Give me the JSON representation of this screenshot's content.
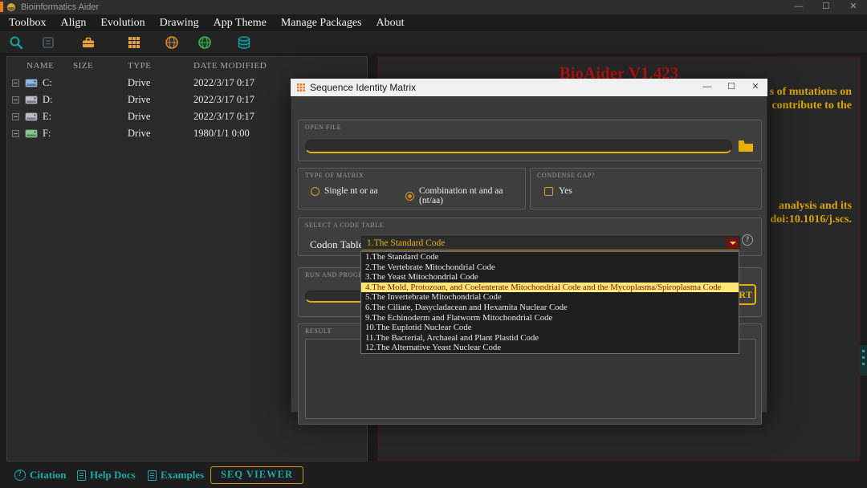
{
  "colors": {
    "accent_gold": "#e8b004",
    "brand_red": "#b41414",
    "teal": "#1fa8a8",
    "highlight_yellow": "#ffe876",
    "combo_arrow_red": "#6e1414"
  },
  "window": {
    "title": "Bioinformatics Aider",
    "minimize": "—",
    "maximize": "☐",
    "close": "✕"
  },
  "menu": {
    "items": [
      {
        "label": "Toolbox"
      },
      {
        "label": "Align"
      },
      {
        "label": "Evolution"
      },
      {
        "label": "Drawing"
      },
      {
        "label": "App Theme"
      },
      {
        "label": "Manage Packages"
      },
      {
        "label": "About"
      }
    ]
  },
  "toolbar": {
    "icons": [
      "search-icon",
      "align-icon",
      "toolbox-icon",
      "grid-icon",
      "globe-icon",
      "green-globe-icon",
      "database-icon"
    ]
  },
  "file_browser": {
    "columns": {
      "name": "NAME",
      "size": "SIZE",
      "type": "TYPE",
      "date": "DATE MODIFIED"
    },
    "rows": [
      {
        "name": "C:",
        "size": "",
        "type": "Drive",
        "date": "2022/3/17 0:17"
      },
      {
        "name": "D:",
        "size": "",
        "type": "Drive",
        "date": "2022/3/17 0:17"
      },
      {
        "name": "E:",
        "size": "",
        "type": "Drive",
        "date": "2022/3/17 0:17"
      },
      {
        "name": "F:",
        "size": "",
        "type": "Drive",
        "date": "1980/1/1 0:00"
      }
    ]
  },
  "main_panel": {
    "title": "BioAider V1.423",
    "fragments": [
      {
        "text": "s of mutations on"
      },
      {
        "text": "contribute to the"
      },
      {
        "text": "analysis and its"
      },
      {
        "text": "doi:10.1016/j.scs."
      }
    ]
  },
  "dialog": {
    "title": "Sequence Identity Matrix",
    "minimize": "—",
    "maximize": "☐",
    "close": "✕",
    "open_file": {
      "label": "OPEN FILE",
      "value": ""
    },
    "matrix_type": {
      "label": "TYPE OF MATRIX",
      "options": [
        {
          "label": "Single nt or aa",
          "selected": false
        },
        {
          "label": "Combination nt and aa (nt/aa)",
          "selected": true
        }
      ]
    },
    "condense_gap": {
      "label": "CONDENSE GAP?",
      "option": "Yes",
      "checked": false
    },
    "code_table": {
      "label": "SELECT A CODE TABLE",
      "field_label": "Codon Table:",
      "value": "1.The Standard Code",
      "help": "?",
      "highlighted_index": 3,
      "options": [
        {
          "label": "1.The Standard Code"
        },
        {
          "label": "2.The Vertebrate Mitochondrial Code"
        },
        {
          "label": "3.The Yeast Mitochondrial Code"
        },
        {
          "label": "4.The Mold, Protozoan, and Coelenterate Mitochondrial Code and the Mycoplasma/Spiroplasma Code"
        },
        {
          "label": "5.The Invertebrate Mitochondrial Code"
        },
        {
          "label": "6.The Ciliate, Dasycladacean and Hexamita Nuclear Code"
        },
        {
          "label": "9.The Echinoderm and Flatworm Mitochondrial Code"
        },
        {
          "label": "10.The Euplotid Nuclear Code"
        },
        {
          "label": "11.The Bacterial, Archaeal and Plant Plastid Code"
        },
        {
          "label": "12.The Alternative Yeast Nuclear Code"
        }
      ]
    },
    "run": {
      "label": "RUN AND PROGRESS",
      "start": "START"
    },
    "result": {
      "label": "RESULT"
    }
  },
  "status_bar": {
    "citation": "Citation",
    "help_docs": "Help Docs",
    "examples": "Examples",
    "seq_viewer": "SEQ VIEWER"
  }
}
